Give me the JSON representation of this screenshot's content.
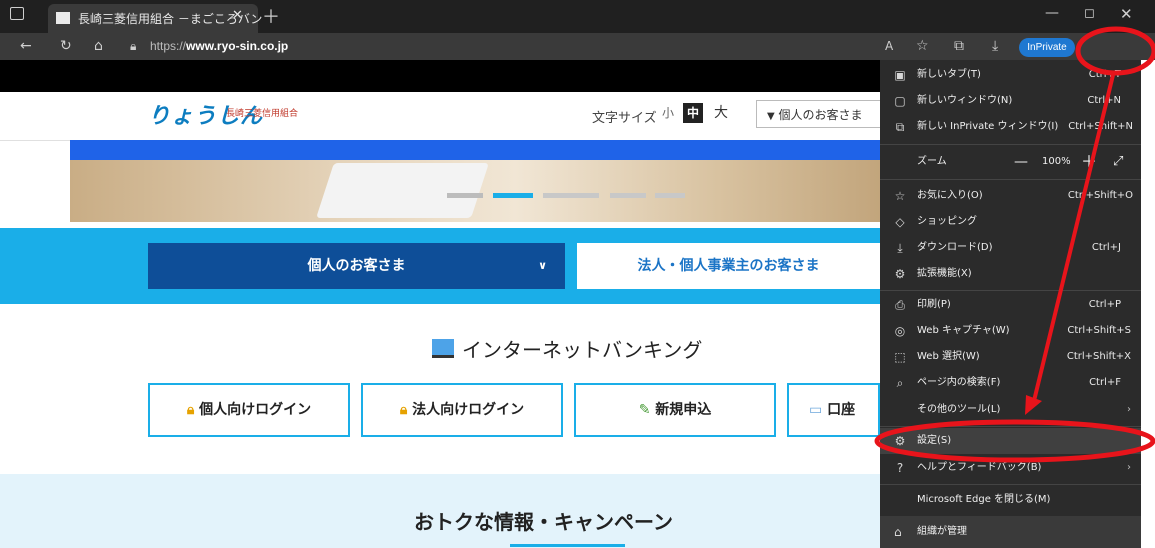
{
  "browser": {
    "tab_title": "長崎三菱信用組合 －まごころバン",
    "tab_favicon_text": "りょうしん",
    "url_prefix": "https://",
    "url_domain": "www.ryo-sin.co.jp",
    "inprivate_label": "InPrivate"
  },
  "site": {
    "logo_text": "りょうしん",
    "logo_sub": "長崎三菱信用組合",
    "font_size_label": "文字サイズ",
    "font_sizes": [
      "小",
      "中",
      "大"
    ],
    "customer_select": "個人のお客さま",
    "segment_personal": "個人のお客さま",
    "segment_corporate": "法人・個人事業主のお客さま",
    "ib_title": "インターネットバンキング",
    "ib_buttons": [
      "個人向けログイン",
      "法人向けログイン",
      "新規申込",
      "口座"
    ],
    "campaign_title": "おトクな情報・キャンペーン"
  },
  "menu": {
    "items": [
      {
        "label": "新しいタブ(T)",
        "shortcut": "Ctrl+T",
        "icon": "new-tab-icon"
      },
      {
        "label": "新しいウィンドウ(N)",
        "shortcut": "Ctrl+N",
        "icon": "new-window-icon"
      },
      {
        "label": "新しい InPrivate ウィンドウ(I)",
        "shortcut": "Ctrl+Shift+N",
        "icon": "inprivate-window-icon"
      },
      {
        "label": "ズーム",
        "zoom_value": "100%",
        "icon": ""
      },
      {
        "label": "お気に入り(O)",
        "shortcut": "Ctrl+Shift+O",
        "icon": "favorites-icon"
      },
      {
        "label": "ショッピング",
        "shortcut": "",
        "icon": "shopping-icon"
      },
      {
        "label": "ダウンロード(D)",
        "shortcut": "Ctrl+J",
        "icon": "download-icon"
      },
      {
        "label": "拡張機能(X)",
        "shortcut": "",
        "icon": "extensions-icon"
      },
      {
        "label": "印刷(P)",
        "shortcut": "Ctrl+P",
        "icon": "print-icon"
      },
      {
        "label": "Web キャプチャ(W)",
        "shortcut": "Ctrl+Shift+S",
        "icon": "web-capture-icon"
      },
      {
        "label": "Web 選択(W)",
        "shortcut": "Ctrl+Shift+X",
        "icon": "web-select-icon"
      },
      {
        "label": "ページ内の検索(F)",
        "shortcut": "Ctrl+F",
        "icon": "find-icon"
      },
      {
        "label": "その他のツール(L)",
        "shortcut": "",
        "icon": ""
      },
      {
        "label": "設定(S)",
        "shortcut": "",
        "icon": "settings-icon"
      },
      {
        "label": "ヘルプとフィードバック(B)",
        "shortcut": "",
        "icon": "help-icon"
      },
      {
        "label": "Microsoft Edge を閉じる(M)",
        "shortcut": "",
        "icon": ""
      },
      {
        "label": "組織が管理",
        "shortcut": "",
        "icon": "managed-icon"
      }
    ]
  },
  "annotation_color": "#e8141b"
}
